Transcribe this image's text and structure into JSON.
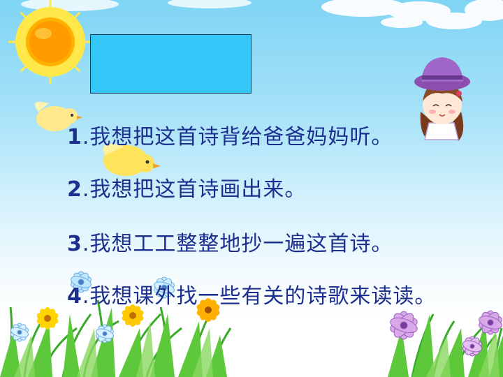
{
  "slide": {
    "title_box_color": "#33c6f6",
    "text_color": "#1c2f8e",
    "lines": [
      {
        "number": "1",
        "text": ".我想把这首诗背给爸爸妈妈听。"
      },
      {
        "number": "2",
        "text": ".我想把这首诗画出来。"
      },
      {
        "number": "3",
        "text": ".我想工工整整地抄一遍这首诗。"
      },
      {
        "number": "4",
        "text": ".我想课外找一些有关的诗歌来读读。"
      }
    ]
  }
}
